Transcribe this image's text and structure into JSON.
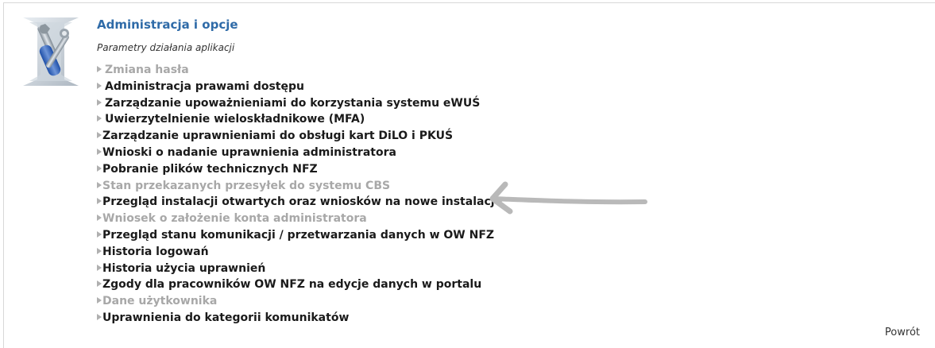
{
  "section": {
    "title": "Administracja i opcje",
    "subtitle": "Parametry działania aplikacji",
    "icon": "admin-tools-icon"
  },
  "menu": {
    "items": [
      {
        "label": "Zmiana hasła",
        "enabled": false
      },
      {
        "label": "Administracja prawami dostępu",
        "enabled": true
      },
      {
        "label": "Zarządzanie upoważnieniami do korzystania systemu eWUŚ",
        "enabled": true
      },
      {
        "label": "Uwierzytelnienie wieloskładnikowe (MFA)",
        "enabled": true
      },
      {
        "label": "Zarządzanie uprawnieniami do obsługi kart DiLO i PKUŚ",
        "enabled": true
      },
      {
        "label": "Wnioski o nadanie uprawnienia administratora",
        "enabled": true
      },
      {
        "label": "Pobranie plików technicznych NFZ",
        "enabled": true
      },
      {
        "label": "Stan przekazanych przesyłek do systemu CBS",
        "enabled": false
      },
      {
        "label": "Przegląd instalacji otwartych oraz wniosków na nowe instalacje",
        "enabled": true
      },
      {
        "label": "Wniosek o założenie konta administratora",
        "enabled": false
      },
      {
        "label": "Przegląd stanu komunikacji / przetwarzania danych w OW NFZ",
        "enabled": true
      },
      {
        "label": "Historia logowań",
        "enabled": true
      },
      {
        "label": "Historia użycia uprawnień",
        "enabled": true
      },
      {
        "label": "Zgody dla pracowników OW NFZ na edycje danych w portalu",
        "enabled": true
      },
      {
        "label": "Dane użytkownika",
        "enabled": false
      },
      {
        "label": "Uprawnienia do kategorii komunikatów",
        "enabled": true
      }
    ]
  },
  "footer": {
    "back_label": "Powrót"
  },
  "colors": {
    "title": "#2f6ba8",
    "enabled_text": "#1a1a1a",
    "disabled_text": "#a8a8a8",
    "arrow": "#b0b0b0"
  }
}
